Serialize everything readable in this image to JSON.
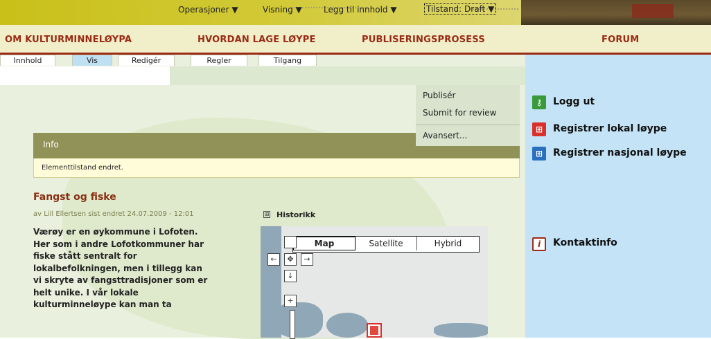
{
  "top_nav": {
    "items": [
      {
        "label": "OM KULTURMINNELØYPA"
      },
      {
        "label": "HVORDAN LAGE LØYPE"
      },
      {
        "label": "PUBLISERINGSPROSESS"
      },
      {
        "label": "FORUM"
      }
    ],
    "color": "#9a2a14"
  },
  "tabs": [
    {
      "label": "Innhold"
    },
    {
      "label": "Vis",
      "active": true
    },
    {
      "label": "Redigér"
    },
    {
      "label": "Regler"
    },
    {
      "label": "Tilgang"
    }
  ],
  "operations": {
    "operasjoner": "Operasjoner ▼",
    "visning": "Visning ▼",
    "legg_til": "Legg til innhold ▼",
    "tilstand": "Tilstand: Draft ▼"
  },
  "state_menu": {
    "items": [
      "Publisér",
      "Submit for review",
      "Avansert..."
    ]
  },
  "info": {
    "title": "Info",
    "message": "Elementtilstand endret."
  },
  "article": {
    "title": "Fangst og fiske",
    "meta_prefix": "av ",
    "author": "Lill Ellertsen",
    "meta_suffix": " sist endret 24.07.2009 - 12:01",
    "history_icon": "⊞",
    "history_label": "Historikk",
    "body_lines": [
      "Værøy er en øykommune i Lofoten.",
      "Her som i andre Lofotkommuner har",
      "fiske stått sentralt for",
      "lokalbefolkningen, men i tillegg kan",
      "vi skryte av fangsttradisjoner som er",
      "helt unike. I vår lokale",
      "kulturminneløype kan man ta"
    ]
  },
  "map": {
    "types": [
      "Map",
      "Satellite",
      "Hybrid"
    ],
    "selected": "Map",
    "pan": {
      "left": "←",
      "center": "✥",
      "right": "→",
      "down": "↓",
      "zoom_in": "+"
    }
  },
  "sidebar": {
    "links": [
      {
        "label": "Logg ut",
        "icon": "key-icon",
        "color": "#3a9a3a"
      },
      {
        "label": "Registrer lokal løype",
        "icon": "grid-red-icon",
        "color": "#d9302c"
      },
      {
        "label": "Registrer nasjonal løype",
        "icon": "grid-blue-icon",
        "color": "#2a6fc0"
      },
      {
        "label": "Kontaktinfo",
        "icon": "info-icon",
        "glyph": "i",
        "color": "#a02a14"
      }
    ]
  }
}
